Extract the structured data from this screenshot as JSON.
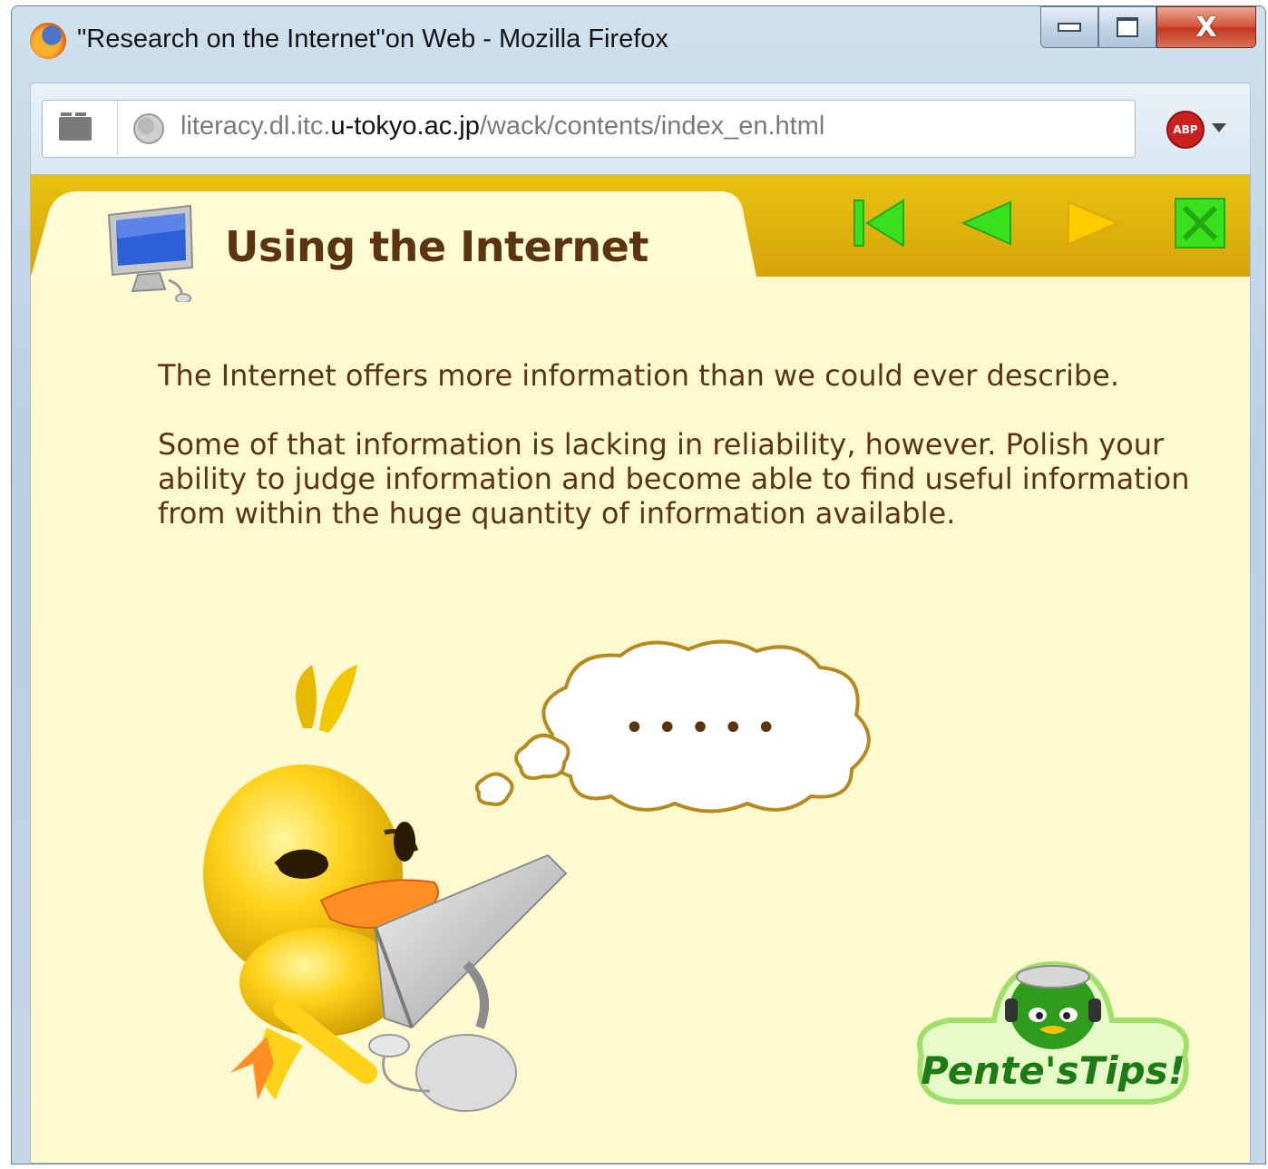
{
  "window": {
    "title": "\"Research on the Internet\"on Web - Mozilla Firefox",
    "controls": {
      "minimize": "minimize",
      "maximize": "maximize",
      "close": "X"
    }
  },
  "toolbar": {
    "url_prefix": "literacy.dl.itc.",
    "url_host": "u-tokyo.ac.jp",
    "url_path": "/wack/contents/index_en.html",
    "addon_label": "ABP"
  },
  "page": {
    "title": "Using the Internet",
    "nav": [
      "first-page",
      "previous-page",
      "next-page",
      "close-page"
    ],
    "paragraphs": [
      "The Internet offers more information than we could ever describe.",
      "Some of that information is lacking in reliability, however. Polish your ability to judge information and become able to find useful information from within the huge quantity of information available."
    ],
    "thought_bubble": "•  •  •  •  •",
    "logo_text": "Pente'sTips!"
  },
  "colors": {
    "content_bg": "#fff9d0",
    "header_gold": "#d6a40a",
    "text_brown": "#5b3510",
    "nav_green": "#39e01e",
    "nav_yellow": "#ffcc00"
  }
}
